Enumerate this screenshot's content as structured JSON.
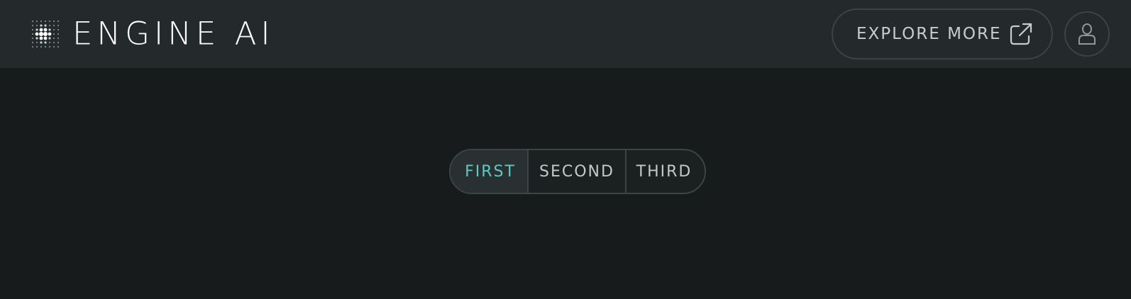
{
  "header": {
    "brand": "ENGINE AI",
    "logo_icon": "dot-grid-logo-icon",
    "explore_label": "EXPLORE MORE",
    "explore_icon": "external-link-icon",
    "user_icon": "user-icon"
  },
  "tabs": {
    "items": [
      {
        "label": "FIRST",
        "selected": true
      },
      {
        "label": "SECOND",
        "selected": false
      },
      {
        "label": "THIRD",
        "selected": false
      }
    ]
  },
  "colors": {
    "header_bg": "#242a2b",
    "page_bg": "#171b1c",
    "accent": "#5fc9c2",
    "text": "#c7cccc",
    "border": "#3b4345"
  }
}
